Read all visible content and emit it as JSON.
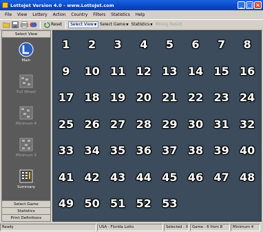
{
  "window": {
    "title": "LottoJet Version 4.0 - www.LottoJet.com",
    "buttons": [
      "_",
      "□",
      "×"
    ]
  },
  "menu": [
    "File",
    "View",
    "Lottery",
    "Action",
    "Country",
    "Filters",
    "Statistics",
    "Help"
  ],
  "toolbar": {
    "icons": [
      "open-folder-icon",
      "save-icon",
      "print-icon",
      "favorites-icon"
    ],
    "reset_label": "Reset",
    "select_view_label": "Select View",
    "select_game_label": "Select Game",
    "statistics_label": "Statistics",
    "mining_result_label": "Mining Result"
  },
  "sidebar": {
    "header": "Select View",
    "items": [
      {
        "label": "Main",
        "icon": "lottojet-logo-icon",
        "enabled": true
      },
      {
        "label": "Full Wheel",
        "icon": "full-wheel-icon",
        "enabled": false
      },
      {
        "label": "Minimum 4",
        "icon": "minimum-4-icon",
        "enabled": false
      },
      {
        "label": "Minimum 5",
        "icon": "minimum-5-icon",
        "enabled": false
      },
      {
        "label": "Summary",
        "icon": "summary-icon",
        "enabled": true
      }
    ],
    "footer": [
      "Select Game",
      "Statistics",
      "Print Definitions"
    ]
  },
  "numbers": [
    "1",
    "2",
    "3",
    "4",
    "5",
    "6",
    "7",
    "8",
    "9",
    "10",
    "11",
    "12",
    "13",
    "14",
    "15",
    "16",
    "17",
    "18",
    "19",
    "20",
    "21",
    "22",
    "23",
    "24",
    "25",
    "26",
    "27",
    "28",
    "29",
    "30",
    "31",
    "32",
    "33",
    "34",
    "35",
    "36",
    "37",
    "38",
    "39",
    "40",
    "41",
    "42",
    "43",
    "44",
    "45",
    "46",
    "47",
    "48",
    "49",
    "50",
    "51",
    "52",
    "53"
  ],
  "status": {
    "ready": "Ready",
    "lottery": "USA - Florida Lotto",
    "selected": "Selected : 0",
    "game": "Game : 6 from 8",
    "minimum": "Minimum 4"
  },
  "colors": {
    "title_bar": "#0a46c8",
    "sidebar_panel": "#5a5a5a",
    "main_background": "#3c4c5c"
  }
}
